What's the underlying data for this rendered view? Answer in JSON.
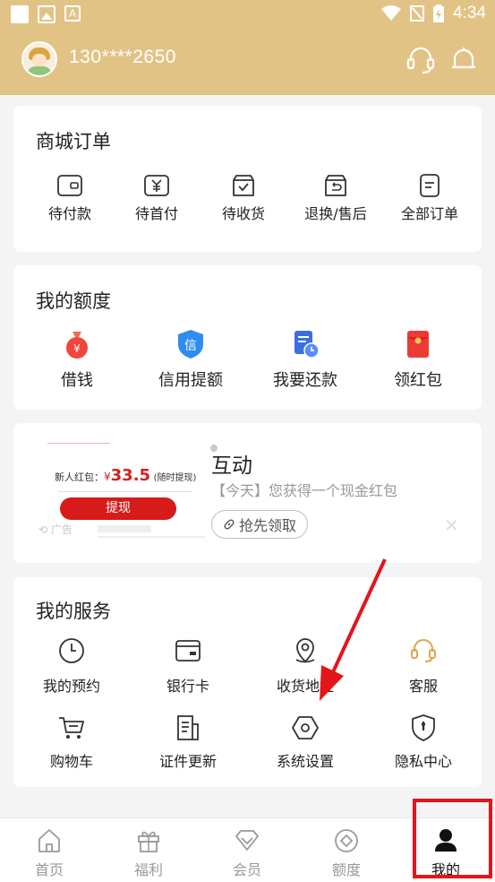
{
  "status_bar": {
    "time": "4:34"
  },
  "header": {
    "phone": "130****2650"
  },
  "mall_orders": {
    "title": "商城订单",
    "items": [
      {
        "label": "待付款",
        "icon": "wallet-icon"
      },
      {
        "label": "待首付",
        "icon": "yen-box-icon"
      },
      {
        "label": "待收货",
        "icon": "package-check-icon"
      },
      {
        "label": "退换/售后",
        "icon": "return-box-icon"
      },
      {
        "label": "全部订单",
        "icon": "document-icon"
      }
    ]
  },
  "quota": {
    "title": "我的额度",
    "items": [
      {
        "label": "借钱",
        "icon": "money-bag-icon"
      },
      {
        "label": "信用提额",
        "icon": "credit-shield-icon"
      },
      {
        "label": "我要还款",
        "icon": "repayment-icon"
      },
      {
        "label": "领红包",
        "icon": "red-packet-icon"
      }
    ]
  },
  "ad": {
    "image_text_1": "新人红包：",
    "image_amount_symbol": "¥",
    "image_amount": "33.5",
    "image_text_2": "(随时提现)",
    "image_button": "提现",
    "ad_mark": "广告",
    "title": "互动",
    "subtitle": "【今天】您获得一个现金红包",
    "button": "抢先领取"
  },
  "services": {
    "title": "我的服务",
    "items": [
      {
        "label": "我的预约",
        "icon": "clock-icon"
      },
      {
        "label": "银行卡",
        "icon": "bank-card-icon"
      },
      {
        "label": "收货地址",
        "icon": "location-pin-icon"
      },
      {
        "label": "客服",
        "icon": "headset-icon"
      },
      {
        "label": "购物车",
        "icon": "cart-icon"
      },
      {
        "label": "证件更新",
        "icon": "id-document-icon"
      },
      {
        "label": "系统设置",
        "icon": "settings-hexagon-icon"
      },
      {
        "label": "隐私中心",
        "icon": "privacy-shield-icon"
      }
    ]
  },
  "tabbar": {
    "items": [
      {
        "label": "首页",
        "icon": "home-icon"
      },
      {
        "label": "福利",
        "icon": "gift-icon"
      },
      {
        "label": "会员",
        "icon": "diamond-icon"
      },
      {
        "label": "额度",
        "icon": "quota-circle-icon"
      },
      {
        "label": "我的",
        "icon": "user-icon",
        "active": true
      }
    ]
  },
  "colors": {
    "header": "#e2c386",
    "accent": "#e4141b",
    "annotation": "#e4141b"
  }
}
